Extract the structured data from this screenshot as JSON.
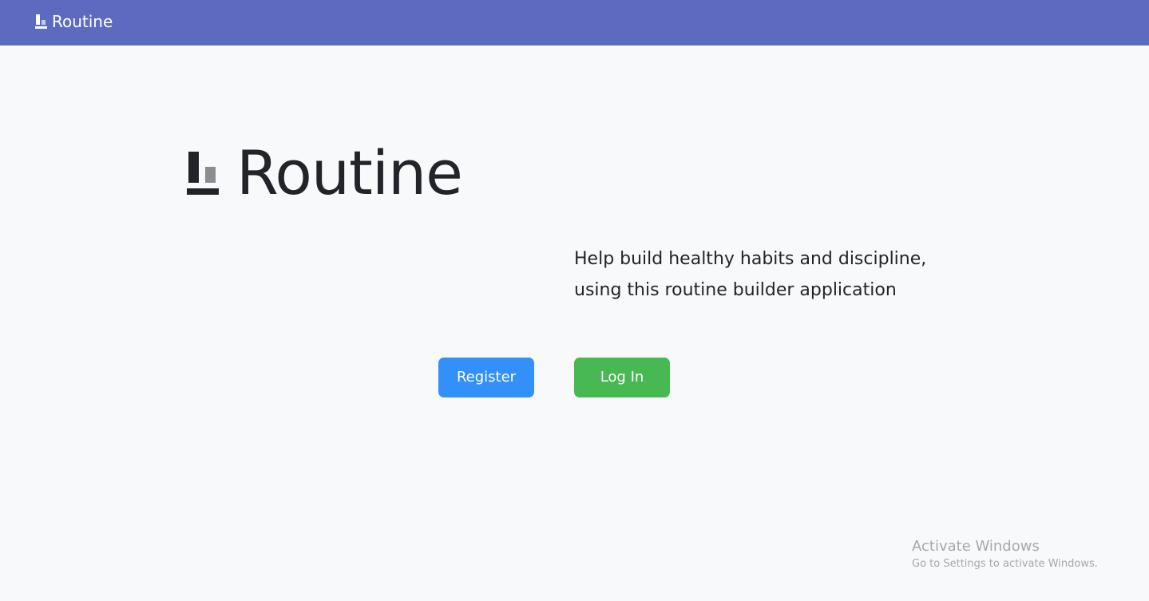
{
  "navbar": {
    "brand_text": "Routine",
    "background_color": "#5c6bc0",
    "logo_icon": "routine-logo-icon"
  },
  "hero": {
    "title": "Routine",
    "logo_icon": "routine-logo-icon"
  },
  "tagline": {
    "line1": "Help build healthy habits and discipline,",
    "line2": "using this routine builder application"
  },
  "actions": {
    "register_label": "Register",
    "register_color": "#3390f8",
    "login_label": "Log In",
    "login_color": "#48b852"
  },
  "watermark": {
    "title": "Activate Windows",
    "subtitle": "Go to Settings to activate Windows."
  }
}
